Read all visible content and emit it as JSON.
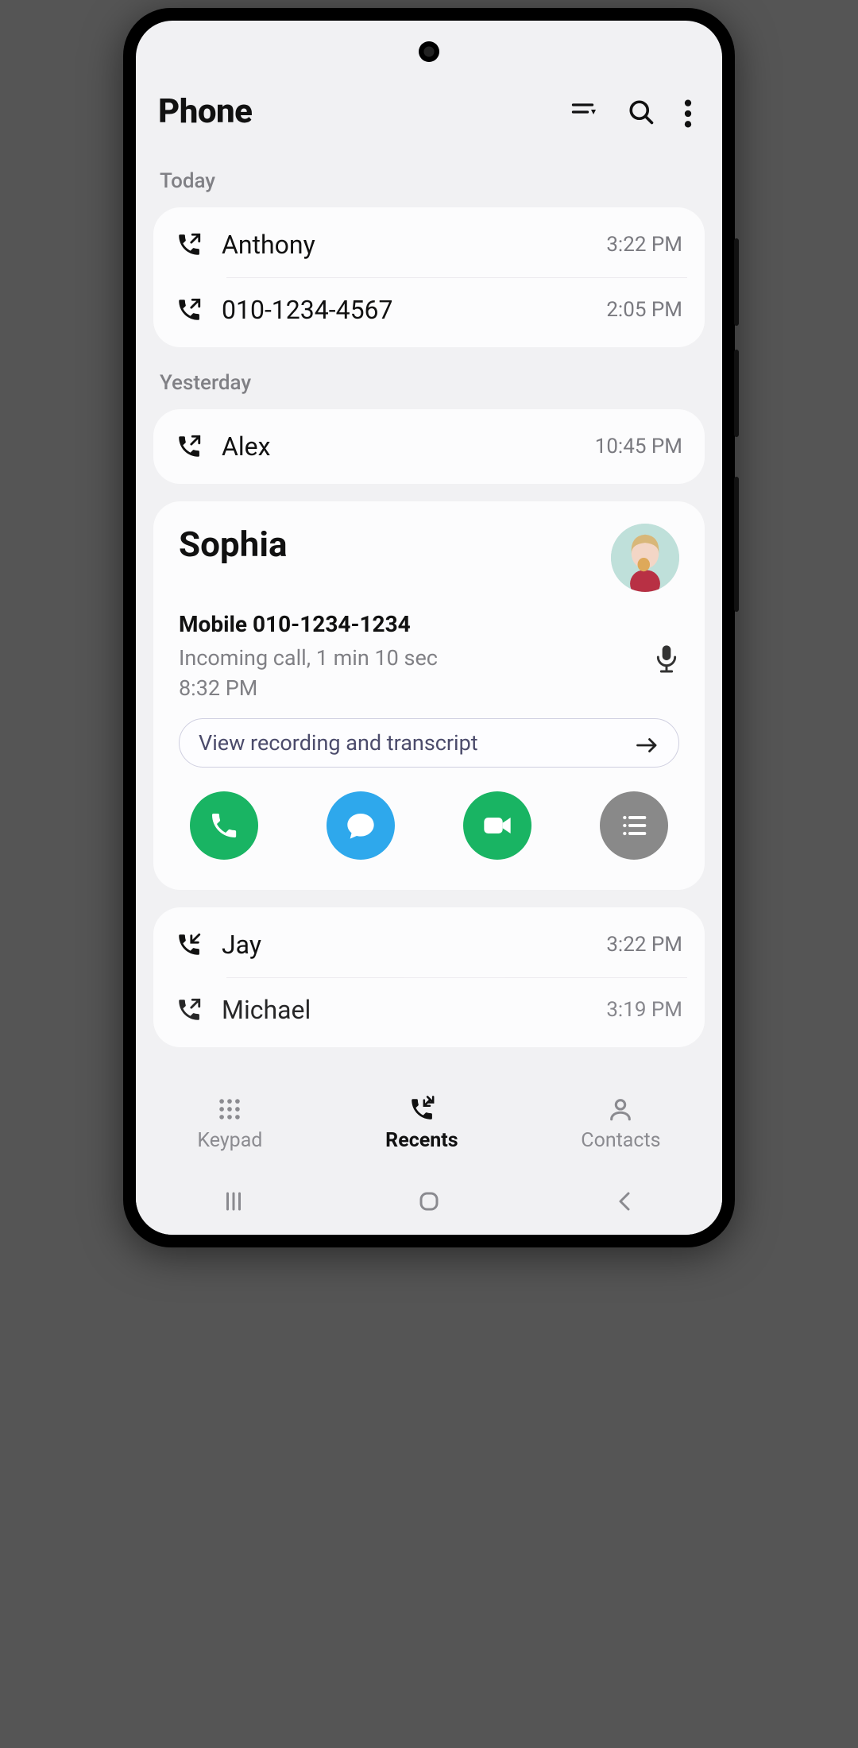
{
  "header": {
    "title": "Phone"
  },
  "sections": {
    "today_label": "Today",
    "yesterday_label": "Yesterday"
  },
  "today": [
    {
      "name": "Anthony",
      "time": "3:22 PM",
      "direction": "outgoing"
    },
    {
      "name": "010-1234-4567",
      "time": "2:05 PM",
      "direction": "outgoing"
    }
  ],
  "yesterday": [
    {
      "name": "Alex",
      "time": "10:45 PM",
      "direction": "outgoing"
    }
  ],
  "expanded": {
    "name": "Sophia",
    "phone_label": "Mobile 010-1234-1234",
    "call_info": "Incoming call, 1 min 10 sec",
    "time": "8:32 PM",
    "transcript_label": "View recording and transcript"
  },
  "more": [
    {
      "name": "Jay",
      "time": "3:22 PM",
      "direction": "incoming"
    },
    {
      "name": "Michael",
      "time": "3:19 PM",
      "direction": "outgoing"
    }
  ],
  "nav": {
    "keypad": "Keypad",
    "recents": "Recents",
    "contacts": "Contacts"
  }
}
